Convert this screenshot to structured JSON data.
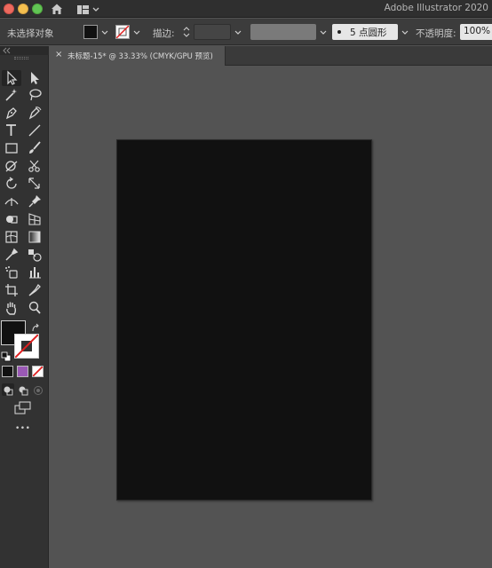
{
  "app": {
    "title": "Adobe Illustrator 2020"
  },
  "control_bar": {
    "selection_status": "未选择对象",
    "fill_color": "#111111",
    "stroke_label": "描边:",
    "brush_preset": "5 点圆形",
    "opacity_label": "不透明度:",
    "opacity_value": "100%"
  },
  "document": {
    "tab_close": "×",
    "tab_title": "未标题-15* @ 33.33% (CMYK/GPU 预览)",
    "artboard_color": "#111111"
  },
  "toolbar": {
    "fill_color": "#111111",
    "more_tools_label": "•••"
  },
  "colors": {
    "ui_bg": "#535353",
    "panel": "#323232",
    "control_bar": "#3c3c3c",
    "swatch_purple": "#9a59b5",
    "none_red": "#e02020"
  }
}
